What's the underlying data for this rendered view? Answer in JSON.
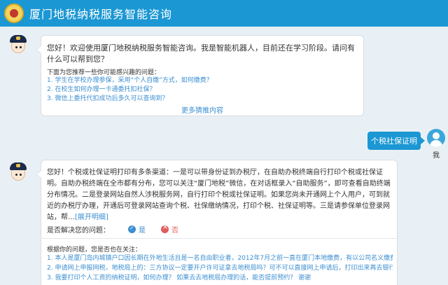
{
  "header": {
    "title": "厦门地税纳税服务智能咨询"
  },
  "welcome": {
    "text": "您好！欢迎使用厦门地税纳税服务智能咨询。我是智能机器人，目前还在学习阶段。请问有什么可以帮到您？",
    "suggestions_title": "下面为您推荐一些你可能感兴趣的问题：",
    "suggestions": [
      "1. 学生在学校办理参保，采用“个人自缴”方式，如何缴费？",
      "2. 在校生如何办理一卡通委托扣社保？",
      "3. 微信上委托代扣成功后多久可以查询到？"
    ],
    "more": "更多猜推内容"
  },
  "user": {
    "message": "个税社保证明",
    "name": "我"
  },
  "answer": {
    "text": "您好！个税或社保证明打印有多条渠道：一是可以带身份证到办税厅，在自助办税终端自行打印个税或社保证明。自助办税终端在全市都有分布，您可以关注“厦门地税”微信，在对话框录入“自助服务”，即可查看自助终端分布情况。二是登录网站自然人涉税服务网，自行打印个税或社保证明。如果您尚未开通网上个人用户，可到就近的办税厅办理，开通后可登录网站查询个税、社保缴纳情况，打印个税、社保证明等。三是请参保单位登录网站，帮…",
    "expand": "[展开明细]",
    "resolved_label": "是否解决您的问题：",
    "yes": "是",
    "no": "否",
    "related_title": "根据你的问题，您是否也在关注：",
    "related": [
      "1. 本人是厦门岛内城镇户口因长期在外地生活且是一名自由职业者，2012年7月之前一直在厦门本地缴费，有以公司名义缴费的也有以个人…",
      "2. 申请网上申报网税，地税局上的：三方协议一定要开户许可证拿去地税局吗？可不可以直接网上申请后，打印出来再去银行签订，然后再…",
      "3. 我要打印个人工资的纳税证明，如何办理？ 如果去去地税局办理的话，能否提前预约？  谢谢"
    ]
  },
  "colors": {
    "header": "#1b97d3",
    "link": "#3b8ed1",
    "background": "#e9f0f5"
  },
  "icons": {
    "logo": "tax-emblem-icon",
    "bot": "robot-avatar-icon",
    "user": "user-avatar-icon"
  }
}
